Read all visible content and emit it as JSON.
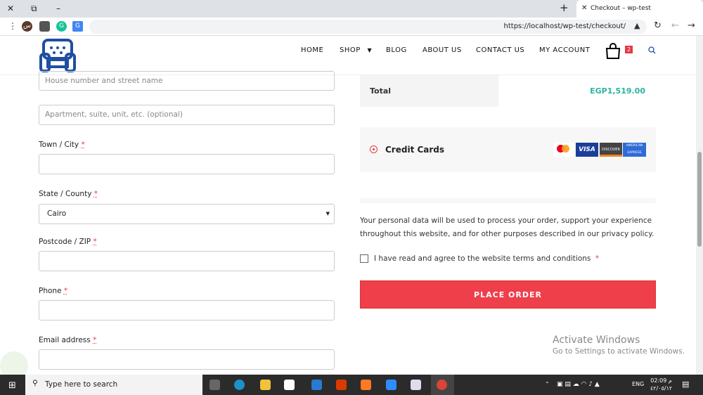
{
  "browser": {
    "tab_title": "Checkout – wp-test",
    "url": "https://localhost/wp-test/checkout/",
    "new_tab": "+",
    "close": "✕",
    "restore": "⧉",
    "minimize": "–"
  },
  "nav": {
    "items": [
      "HOME",
      "SHOP",
      "BLOG",
      "ABOUT US",
      "CONTACT US",
      "MY ACCOUNT"
    ],
    "cart_count": "2"
  },
  "form": {
    "street_placeholder": "House number and street name",
    "apartment_placeholder": "Apartment, suite, unit, etc. (optional)",
    "town_label": "Town / City",
    "state_label": "State / County",
    "state_value": "Cairo",
    "postcode_label": "Postcode / ZIP",
    "phone_label": "Phone",
    "email_label": "Email address",
    "required": "*"
  },
  "order": {
    "total_label": "Total",
    "total_value": "EGP1,519.00",
    "payment_method": "Credit Cards",
    "cards": [
      "VISA",
      "DISCOVER",
      "AMERICAN EXPRESS",
      "mastercard"
    ],
    "privacy_text": "Your personal data will be used to process your order, support your experience throughout this website, and for other purposes described in our ",
    "privacy_link": "privacy policy",
    "terms_prefix": "I have read and agree to the website ",
    "terms_link": "terms and conditions",
    "place_order": "PLACE ORDER"
  },
  "watermark": {
    "title": "Activate Windows",
    "subtitle": "Go to Settings to activate Windows."
  },
  "taskbar": {
    "search_placeholder": "Type here to search",
    "lang": "ENG",
    "time": "02:09 م",
    "date": "٤٢/٠٥/١٢"
  },
  "colors": {
    "accent": "#ee3f4b",
    "price": "#2bb5a0",
    "logo": "#1f4fa0"
  }
}
